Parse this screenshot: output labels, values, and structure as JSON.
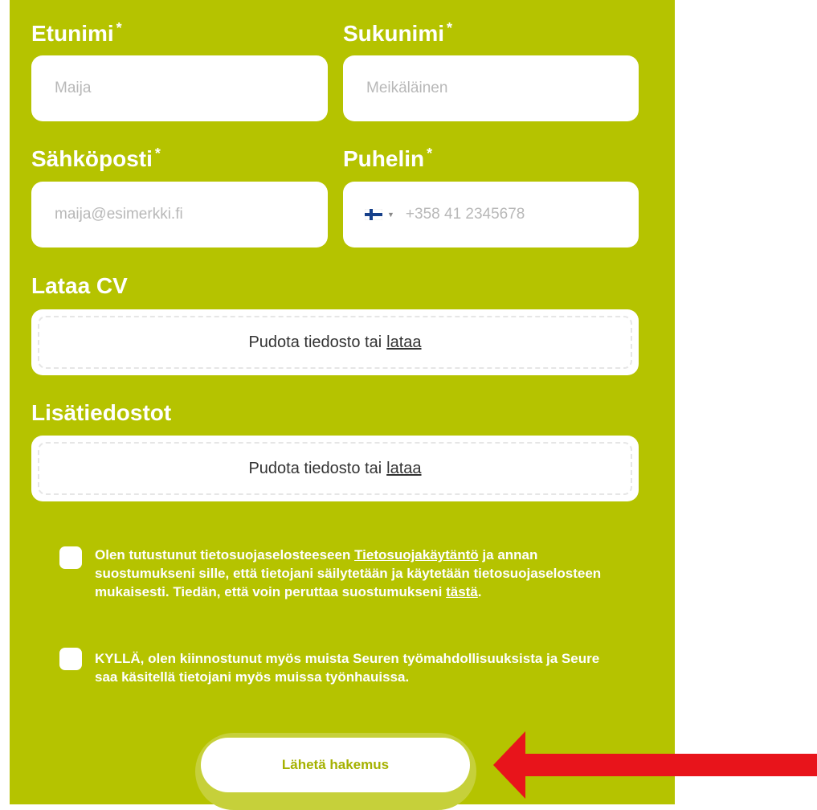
{
  "form": {
    "first_name": {
      "label": "Etunimi",
      "required_mark": "*",
      "placeholder": "Maija"
    },
    "last_name": {
      "label": "Sukunimi",
      "required_mark": "*",
      "placeholder": "Meikäläinen"
    },
    "email": {
      "label": "Sähköposti",
      "required_mark": "*",
      "placeholder": "maija@esimerkki.fi"
    },
    "phone": {
      "label": "Puhelin",
      "required_mark": "*",
      "placeholder": "+358 41 2345678",
      "country_icon": "finland-flag-icon"
    },
    "cv_upload": {
      "label": "Lataa CV",
      "drop_text": "Pudota tiedosto tai",
      "link_text": "lataa"
    },
    "attachments_upload": {
      "label": "Lisätiedostot",
      "drop_text": "Pudota tiedosto tai",
      "link_text": "lataa"
    },
    "consent_privacy": {
      "text_before": "Olen tutustunut tietosuojaselosteeseen",
      "link1": "Tietosuojakäytäntö",
      "text_middle": "ja annan suostumukseni sille, että tietojani säilytetään ja käytetään tietosuojaselosteen mukaisesti. Tiedän, että voin peruttaa suostumukseni",
      "link2": "tästä",
      "text_end": "."
    },
    "consent_other_jobs": {
      "text": "KYLLÄ, olen kiinnostunut myös muista Seuren työmahdollisuuksista ja Seure saa käsitellä tietojani myös muissa työnhauissa."
    },
    "submit_label": "Lähetä hakemus"
  },
  "colors": {
    "panel": "#b5c300",
    "annotation_arrow": "#e8141b"
  }
}
